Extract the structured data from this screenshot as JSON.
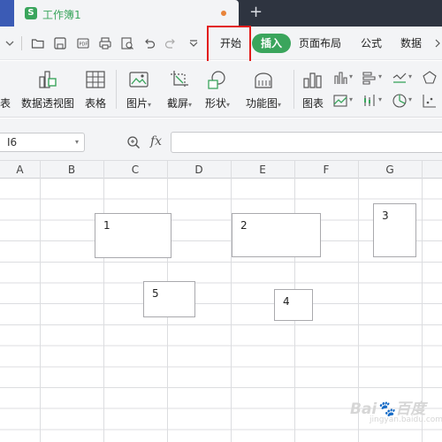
{
  "titlebar": {
    "tab_title": "工作簿1",
    "app_icon_letter": "S",
    "new_tab": "+"
  },
  "menubar": {
    "items": [
      "开始",
      "插入",
      "页面布局",
      "公式",
      "数据"
    ],
    "active_item": "插入",
    "highlighted_item": "开始"
  },
  "ribbon": {
    "items": [
      {
        "label": "表",
        "icon": "table-icon"
      },
      {
        "label": "数据透视图",
        "icon": "pivot-chart-icon"
      },
      {
        "label": "表格",
        "icon": "table-grid-icon"
      },
      {
        "label": "图片",
        "icon": "picture-icon"
      },
      {
        "label": "截屏",
        "icon": "screenshot-icon"
      },
      {
        "label": "形状",
        "icon": "shape-icon"
      },
      {
        "label": "功能图",
        "icon": "function-chart-icon"
      },
      {
        "label": "图表",
        "icon": "chart-icon"
      }
    ]
  },
  "formulabar": {
    "cell_ref": "I6",
    "fx": "fx",
    "formula_value": ""
  },
  "sheet": {
    "columns": [
      "A",
      "B",
      "C",
      "D",
      "E",
      "F",
      "G"
    ],
    "textboxes": [
      "1",
      "2",
      "3",
      "4",
      "5"
    ]
  },
  "watermark": {
    "text": "Bai🐾百度",
    "sub": "jingyan.baidu.com"
  },
  "colors": {
    "accent_green": "#3aa55c",
    "highlight_red": "#e21b1b",
    "titlebar": "#2e3440"
  }
}
